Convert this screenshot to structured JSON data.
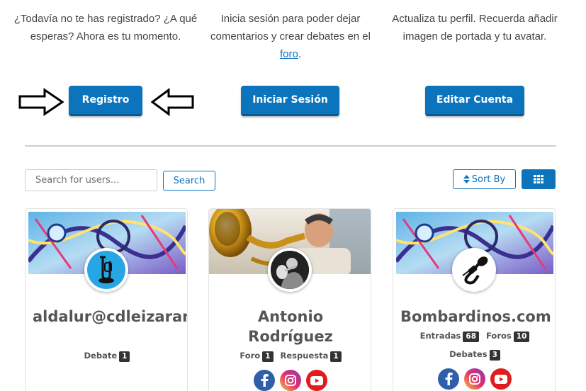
{
  "intro": [
    {
      "text": "¿Todavía no te has registrado? ¿A qué esperas? Ahora es tu momento."
    },
    {
      "text_before": "Inicia sesión para poder dejar comentarios y crear debates en el ",
      "link": "foro",
      "text_after": "."
    },
    {
      "text": "Actualiza tu perfil. Recuerda añadir imagen de portada y tu avatar."
    }
  ],
  "actions": {
    "register_label": "Registro",
    "login_label": "Iniciar Sesión",
    "edit_label": "Editar Cuenta"
  },
  "toolbar": {
    "search_placeholder": "Search for users...",
    "search_label": "Search",
    "sort_label": "Sort By",
    "sort_icon": "sort-icon",
    "view_icon": "grid-icon"
  },
  "colors": {
    "accent": "#0b74bd",
    "badge": "#333333",
    "facebook": "#2f5fa8",
    "youtube": "#e21c1c"
  },
  "users": [
    {
      "name": "aldalur@cdleizaran.com",
      "stats": [
        {
          "label": "Debate",
          "count": "1"
        }
      ],
      "socials": []
    },
    {
      "name": "Antonio Rodríguez",
      "stats": [
        {
          "label": "Foro",
          "count": "1"
        },
        {
          "label": "Respuesta",
          "count": "1"
        }
      ],
      "socials": [
        "facebook-icon",
        "instagram-icon",
        "youtube-icon"
      ]
    },
    {
      "name": "Bombardinos.com",
      "stats": [
        {
          "label": "Entradas",
          "count": "68"
        },
        {
          "label": "Foros",
          "count": "10"
        },
        {
          "label": "Debates",
          "count": "3"
        }
      ],
      "socials": [
        "facebook-icon",
        "instagram-icon",
        "youtube-icon"
      ]
    }
  ]
}
